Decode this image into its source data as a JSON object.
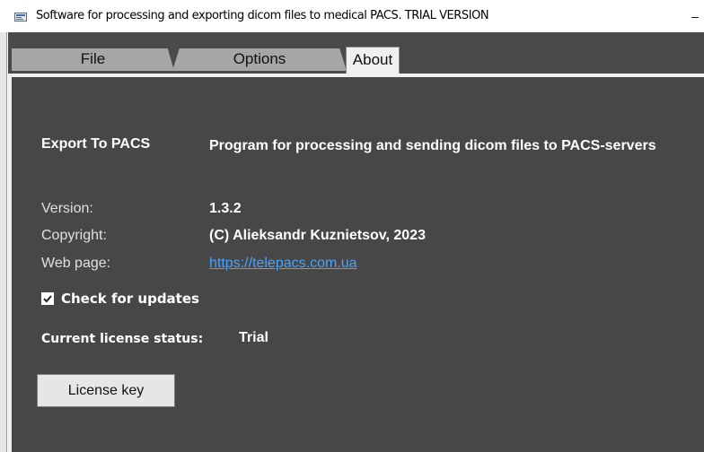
{
  "window": {
    "title": "Software for processing and exporting dicom files to medical PACS. TRIAL VERSION",
    "minimize_glyph": "–"
  },
  "tabs": [
    {
      "label": "File"
    },
    {
      "label": "Options"
    },
    {
      "label": "About",
      "selected": true
    }
  ],
  "about": {
    "app_name": "Export To PACS",
    "description": "Program for processing and sending dicom files to PACS-servers",
    "version_label": "Version:",
    "version_value": "1.3.2",
    "copyright_label": "Copyright:",
    "copyright_value": "(C) Alieksandr Kuznietsov, 2023",
    "web_label": "Web page:",
    "web_value": "https://telepacs.com.ua",
    "check_updates_label": "Check for updates",
    "check_updates_checked": true,
    "license_status_label": "Current license status:",
    "license_status_value": "Trial",
    "license_button_label": "License key"
  },
  "colors": {
    "panel_bg": "#474747",
    "tabstrip_bg": "#4a4a4a",
    "link": "#4aa3ff",
    "text": "#ffffff"
  },
  "icons": {
    "app": "app-window-icon",
    "checkbox": "checkmark-icon"
  }
}
